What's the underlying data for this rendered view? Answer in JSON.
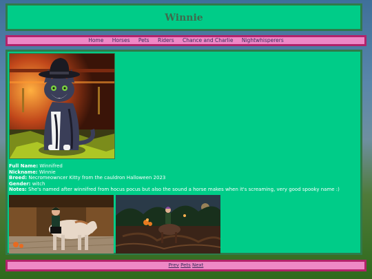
{
  "site_title": "Winnie",
  "nav": {
    "items": [
      "Home",
      "Horses",
      "Pets",
      "Riders",
      "Chance and Charlie",
      "Nightwhisperers"
    ]
  },
  "profile": {
    "full_name_label": "Full Name:",
    "full_name": "Winnifred",
    "nickname_label": "Nickname:",
    "nickname": "Winnie",
    "breed_label": "Breed:",
    "breed": "Necromeowncer Kitty from the cauldron Halloween 2023",
    "gender_label": "Gender:",
    "gender": "witch",
    "notes_label": "Notes:",
    "notes": "She's named after winnifred from hocus pocus but also the sound a horse makes when it's screaming, very good spooky name :)"
  },
  "footer": {
    "prev": "Prev",
    "pets": "Pets",
    "next": "Next"
  },
  "colors": {
    "panel": "#00cc88",
    "panel_border": "#2f7a4a",
    "nav_bg": "#ee88c6",
    "nav_border": "#b2226a"
  }
}
